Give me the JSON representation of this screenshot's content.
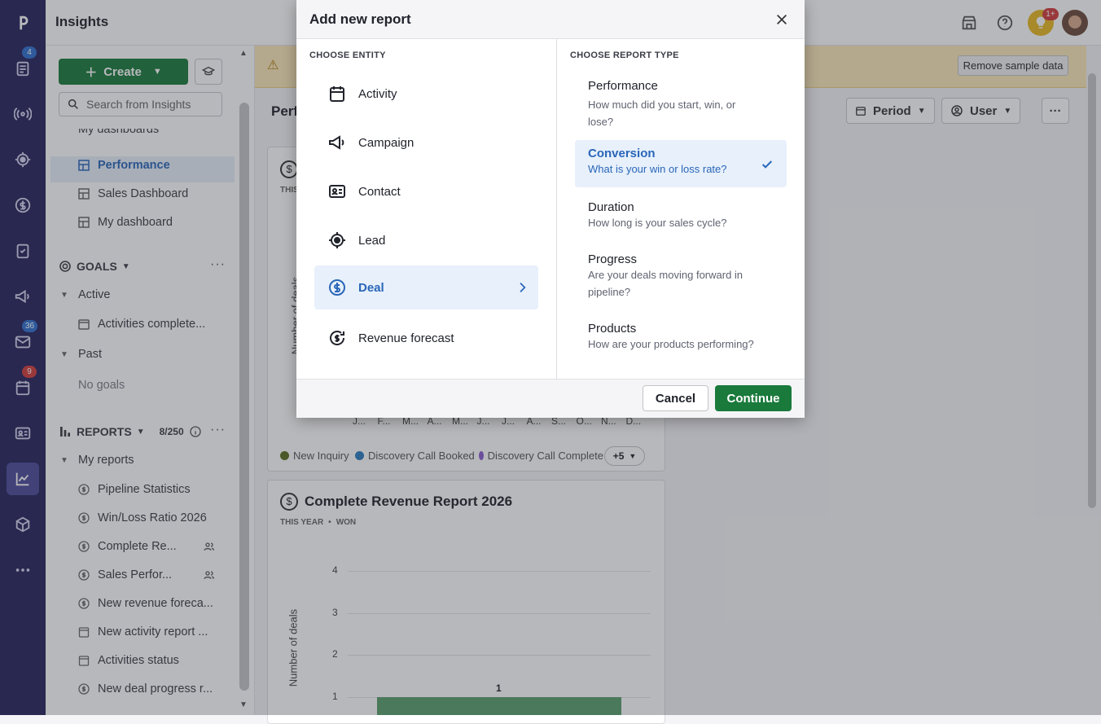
{
  "app": {
    "title": "Insights"
  },
  "rail": {
    "badges": {
      "deals_count": "4",
      "mail_count": "36",
      "activities_count": "9"
    }
  },
  "topbar": {
    "notif_badge": "1+"
  },
  "sidebar": {
    "create_label": "Create",
    "search_placeholder": "Search from Insights",
    "dashboards_header": "My dashboards",
    "dashboards": [
      "Performance",
      "Sales Dashboard",
      "My dashboard"
    ],
    "goals_header": "GOALS",
    "goals_active": "Active",
    "goals_active_item": "Activities complete...",
    "goals_past": "Past",
    "goals_none": "No goals",
    "reports_header": "REPORTS",
    "reports_count": "8/250",
    "my_reports": "My reports",
    "reports": [
      "Pipeline Statistics",
      "Win/Loss Ratio 2026",
      "Complete Re...",
      "Sales Perfor...",
      "New revenue foreca...",
      "New activity report ...",
      "Activities status",
      "New deal progress r..."
    ]
  },
  "main": {
    "remove_sample": "Remove sample data",
    "page_title_partial": "Perf",
    "period_label": "Period",
    "user_label": "User",
    "card1": {
      "sub_partial": "THIS",
      "ylabel": "Number of deals",
      "months": [
        "J...",
        "F...",
        "M...",
        "A...",
        "M...",
        "J...",
        "J...",
        "A...",
        "S...",
        "O...",
        "N...",
        "D..."
      ],
      "legend": [
        "New Inquiry",
        "Discovery Call Booked",
        "Discovery Call Complete"
      ],
      "more": "+5"
    },
    "card2": {
      "title": "Complete Revenue Report 2026",
      "sub1": "THIS YEAR",
      "sub2": "WON",
      "ylabel": "Number of deals"
    }
  },
  "chart_data": {
    "type": "bar",
    "title": "Complete Revenue Report 2026",
    "ylabel": "Number of deals",
    "ylim": [
      0,
      4
    ],
    "yticks": [
      "4",
      "3",
      "2",
      "1"
    ],
    "values": [
      1
    ],
    "data_labels": [
      "1"
    ]
  },
  "modal": {
    "title": "Add new report",
    "entity_header": "CHOOSE ENTITY",
    "type_header": "CHOOSE REPORT TYPE",
    "entities": [
      "Activity",
      "Campaign",
      "Contact",
      "Lead",
      "Deal",
      "Revenue forecast"
    ],
    "types": [
      {
        "title": "Performance",
        "desc": "How much did you start, win, or lose?"
      },
      {
        "title": "Conversion",
        "desc": "What is your win or loss rate?"
      },
      {
        "title": "Duration",
        "desc": "How long is your sales cycle?"
      },
      {
        "title": "Progress",
        "desc": "Are your deals moving forward in pipeline?"
      },
      {
        "title": "Products",
        "desc": "How are your products performing?"
      }
    ],
    "cancel": "Cancel",
    "continue": "Continue"
  },
  "colors": {
    "rail": "#26235b",
    "brand_green": "#1a7a3b",
    "selected_blue": "#2a66b8",
    "bar": "#5a9e6c"
  }
}
